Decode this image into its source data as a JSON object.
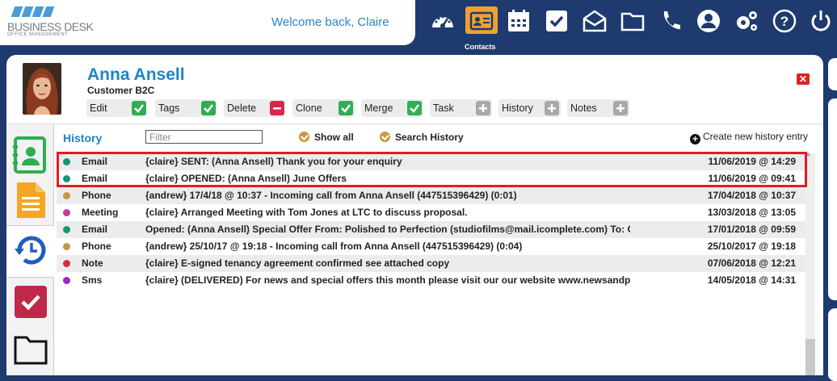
{
  "header": {
    "logo_title": "BUSINESS DESK",
    "logo_subtitle": "OFFICE MANAGEMENT",
    "welcome": "Welcome back, Claire",
    "active_nav_label": "Contacts",
    "nav_icons": [
      "dashboard-icon",
      "contacts-icon",
      "calendar-icon",
      "tasks-icon",
      "mail-icon",
      "folder-icon",
      "phone-icon",
      "user-icon",
      "settings-icon",
      "help-icon",
      "power-icon"
    ]
  },
  "contact": {
    "name": "Anna Ansell",
    "type": "Customer B2C",
    "actions": [
      {
        "label": "Edit",
        "state": "green"
      },
      {
        "label": "Tags",
        "state": "green"
      },
      {
        "label": "Delete",
        "state": "red"
      },
      {
        "label": "Clone",
        "state": "green"
      },
      {
        "label": "Merge",
        "state": "green"
      },
      {
        "label": "Task",
        "state": "grey"
      },
      {
        "label": "History",
        "state": "grey"
      },
      {
        "label": "Notes",
        "state": "grey"
      }
    ]
  },
  "history": {
    "title": "History",
    "filter_placeholder": "Filter",
    "show_all": "Show all",
    "search_history": "Search History",
    "create_entry": "Create new history entry",
    "rows": [
      {
        "type": "Email",
        "color": "#14967a",
        "desc": "{claire} SENT: (Anna Ansell) Thank you for your enquiry",
        "date": "11/06/2019 @ 14:29"
      },
      {
        "type": "Email",
        "color": "#14967a",
        "desc": "{claire} OPENED: (Anna Ansell) June Offers",
        "date": "11/06/2019 @ 09:41"
      },
      {
        "type": "Phone",
        "color": "#c9963e",
        "desc": "{andrew} 17/4/18 @ 10:37 - Incoming call from Anna Ansell (447515396429) (0:01)",
        "date": "17/04/2018 @ 10:37"
      },
      {
        "type": "Meeting",
        "color": "#c7379e",
        "desc": "{claire} Arranged Meeting with Tom Jones at LTC to discuss proposal.",
        "date": "13/03/2018 @ 13:05"
      },
      {
        "type": "Email",
        "color": "#14967a",
        "desc": "Opened: (Anna Ansell) Special Offer From: Polished to Perfection (studiofilms@mail.icomplete.com) To: Cla",
        "date": "17/01/2018 @ 09:59"
      },
      {
        "type": "Phone",
        "color": "#c9963e",
        "desc": "{andrew} 25/10/17 @ 19:18 - Incoming call from Anna Ansell (447515396429) (0:04)",
        "date": "25/10/2017 @ 19:18"
      },
      {
        "type": "Note",
        "color": "#d8264c",
        "desc": "{claire} E-signed tenancy agreement confirmed see attached copy",
        "date": "07/06/2018 @ 12:21"
      },
      {
        "type": "Sms",
        "color": "#9b27c9",
        "desc": "{claire} (DELIVERED) For news and special offers this month please visit our our website www.newsandpr",
        "date": "14/05/2018 @ 14:31"
      }
    ]
  },
  "colors": {
    "brand": "#1e3a6e",
    "accent": "#1f84c8",
    "highlight": "#e21c24"
  }
}
